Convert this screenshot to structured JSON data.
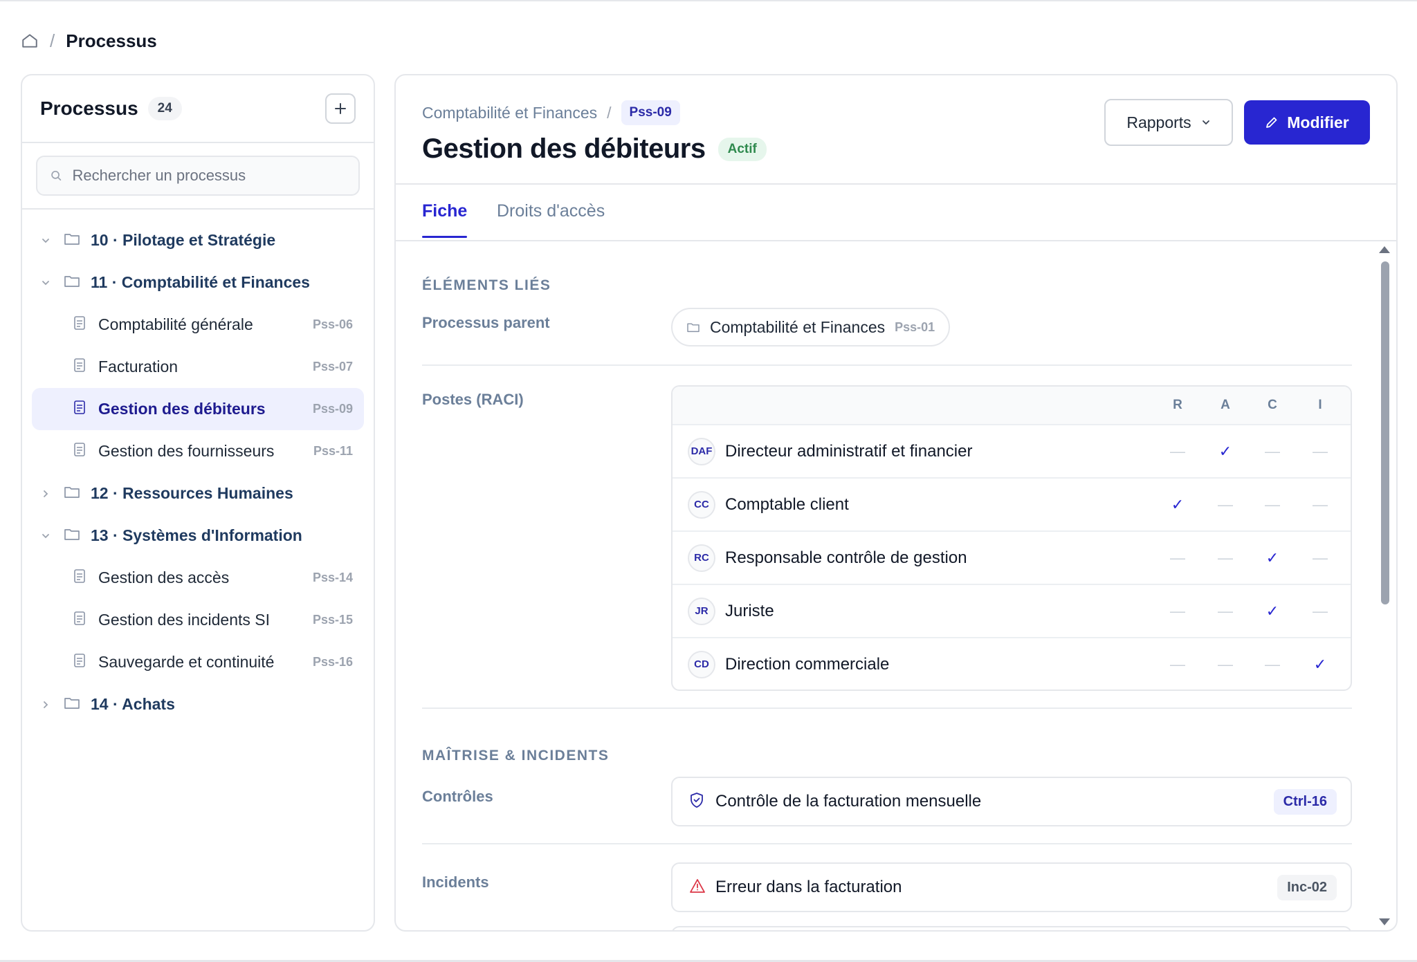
{
  "breadcrumb": {
    "current": "Processus"
  },
  "sidebar": {
    "title": "Processus",
    "count": "24",
    "search_placeholder": "Rechercher un processus",
    "tree": [
      {
        "label": "10 · Pilotage et Stratégie"
      },
      {
        "label": "11 · Comptabilité et Finances"
      },
      {
        "label": "Comptabilité générale",
        "code": "Pss-06"
      },
      {
        "label": "Facturation",
        "code": "Pss-07"
      },
      {
        "label": "Gestion des débiteurs",
        "code": "Pss-09"
      },
      {
        "label": "Gestion des fournisseurs",
        "code": "Pss-11"
      },
      {
        "label": "12 · Ressources Humaines"
      },
      {
        "label": "13 · Systèmes d'Information"
      },
      {
        "label": "Gestion des accès",
        "code": "Pss-14"
      },
      {
        "label": "Gestion des incidents SI",
        "code": "Pss-15"
      },
      {
        "label": "Sauvegarde et continuité",
        "code": "Pss-16"
      },
      {
        "label": "14 · Achats"
      }
    ]
  },
  "main": {
    "parent_link": "Comptabilité et Finances",
    "code": "Pss-09",
    "title": "Gestion des débiteurs",
    "status": "Actif",
    "rapports_label": "Rapports",
    "modifier_label": "Modifier",
    "tabs": [
      {
        "label": "Fiche"
      },
      {
        "label": "Droits d'accès"
      }
    ],
    "linked_section": "ÉLÉMENTS LIÉS",
    "parent_label": "Processus parent",
    "parent_value": "Comptabilité et Finances",
    "parent_code": "Pss-01",
    "raci_label": "Postes (RACI)",
    "raci_columns": [
      "R",
      "A",
      "C",
      "I"
    ],
    "raci_rows": [
      {
        "initials": "DAF",
        "name": "Directeur administratif et financier",
        "r": "—",
        "a": "✓",
        "c": "—",
        "i": "—"
      },
      {
        "initials": "CC",
        "name": "Comptable client",
        "r": "✓",
        "a": "—",
        "c": "—",
        "i": "—"
      },
      {
        "initials": "RC",
        "name": "Responsable contrôle de gestion",
        "r": "—",
        "a": "—",
        "c": "✓",
        "i": "—"
      },
      {
        "initials": "JR",
        "name": "Juriste",
        "r": "—",
        "a": "—",
        "c": "✓",
        "i": "—"
      },
      {
        "initials": "CD",
        "name": "Direction commerciale",
        "r": "—",
        "a": "—",
        "c": "—",
        "i": "✓"
      }
    ],
    "control_section": "MAÎTRISE & INCIDENTS",
    "controls_label": "Contrôles",
    "control_item": {
      "name": "Contrôle de la facturation mensuelle",
      "ref": "Ctrl-16"
    },
    "incidents_label": "Incidents",
    "incident_item": {
      "name": "Erreur dans la facturation",
      "ref": "Inc-02"
    }
  },
  "colors": {
    "accent": "#2826d1",
    "active_bg": "#eef0fe",
    "success": "#2f8a4e",
    "danger": "#dc3545"
  }
}
